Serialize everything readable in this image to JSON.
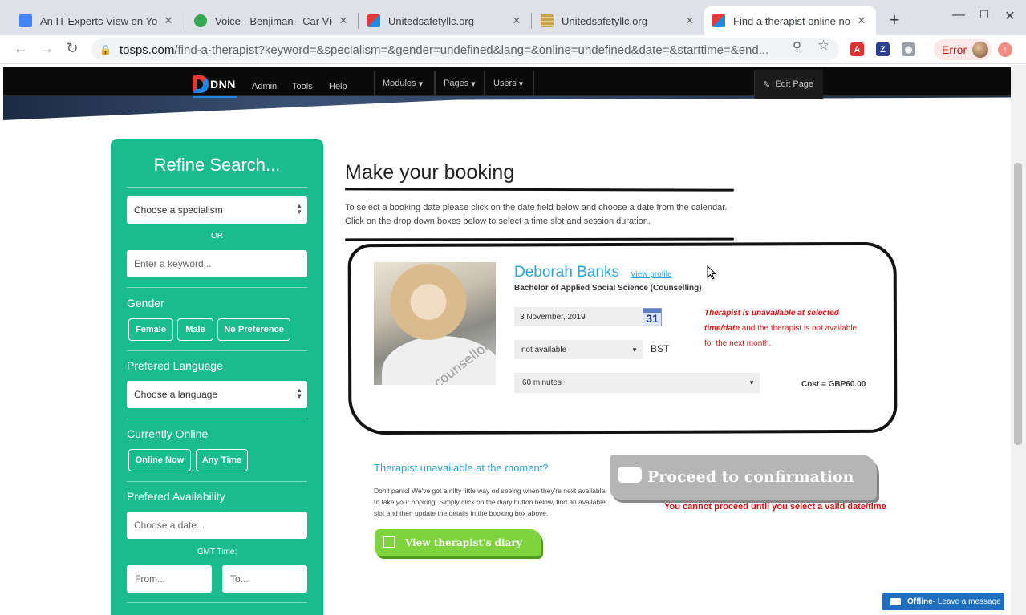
{
  "browser": {
    "tabs": [
      {
        "title": "An IT Experts View on Your",
        "favicon": "docs-icon",
        "color": "#4285f4"
      },
      {
        "title": "Voice - Benjiman - Car Vide",
        "favicon": "phone-icon",
        "color": "#34a853"
      },
      {
        "title": "Unitedsafetyllc.org",
        "favicon": "dnn-icon",
        "color": "#e53935"
      },
      {
        "title": "Unitedsafetyllc.org",
        "favicon": "stack-icon",
        "color": "#c9a24b"
      },
      {
        "title": "Find a therapist online now",
        "favicon": "dnn-icon",
        "color": "#e53935"
      }
    ],
    "url_host": "tosps.com",
    "url_path": "/find-a-therapist?keyword=&specialism=&gender=undefined&lang=&online=undefined&date=&starttime=&end...",
    "error_label": "Error"
  },
  "dnn": {
    "logo": "DNN",
    "links": [
      "Admin",
      "Tools",
      "Help"
    ],
    "menus": [
      "Modules",
      "Pages",
      "Users"
    ],
    "edit_page": "Edit Page"
  },
  "sidebar": {
    "title": "Refine Search...",
    "specialism_select": "Choose a specialism",
    "or_text": "OR",
    "keyword_placeholder": "Enter a keyword...",
    "gender_label": "Gender",
    "gender_buttons": [
      "Female",
      "Male",
      "No Preference"
    ],
    "language_label": "Prefered Language",
    "language_select": "Choose a language",
    "online_label": "Currently Online",
    "online_buttons": [
      "Online Now",
      "Any Time"
    ],
    "availability_label": "Prefered Availability",
    "date_placeholder": "Choose a date...",
    "time_label": "GMT Time:",
    "from_placeholder": "From...",
    "to_placeholder": "To..."
  },
  "booking": {
    "title": "Make your booking",
    "instructions_1": "To select a booking date please click on the date field below and choose a date from the calendar.",
    "instructions_2": "Click on the drop down boxes below to select a time slot and session duration.",
    "therapist_name": "Deborah Banks",
    "view_profile": "View profile",
    "degree": "Bachelor of Applied Social Science (Counselling)",
    "date_value": "3 November, 2019",
    "calendar_day": "31",
    "slot_value": "not available",
    "timezone": "BST",
    "duration_value": "60 minutes",
    "error_bold": "Therapist is unavailable at selected time/date",
    "error_rest": "and the therapist is not available for the next month.",
    "cost": "Cost = GBP60.00",
    "photo_text": "counsellor"
  },
  "unavailable": {
    "title": "Therapist unavailable at the moment?",
    "body": "Don't panic! We've got a nifty little way od seeing when they're next available to take your booking. Simply click on the diary button below, find an available slot and then update the details in the booking box above.",
    "diary_button": "View therapist's diary"
  },
  "proceed": {
    "button": "Proceed to confirmation",
    "error": "You cannot proceed until you select a valid date/time"
  },
  "chat": {
    "status": "Offline",
    "message": " - Leave a message"
  },
  "colors": {
    "sidebar": "#1abc8e",
    "link": "#2aa3d8",
    "error": "#d61414",
    "diary": "#7fd33d"
  }
}
